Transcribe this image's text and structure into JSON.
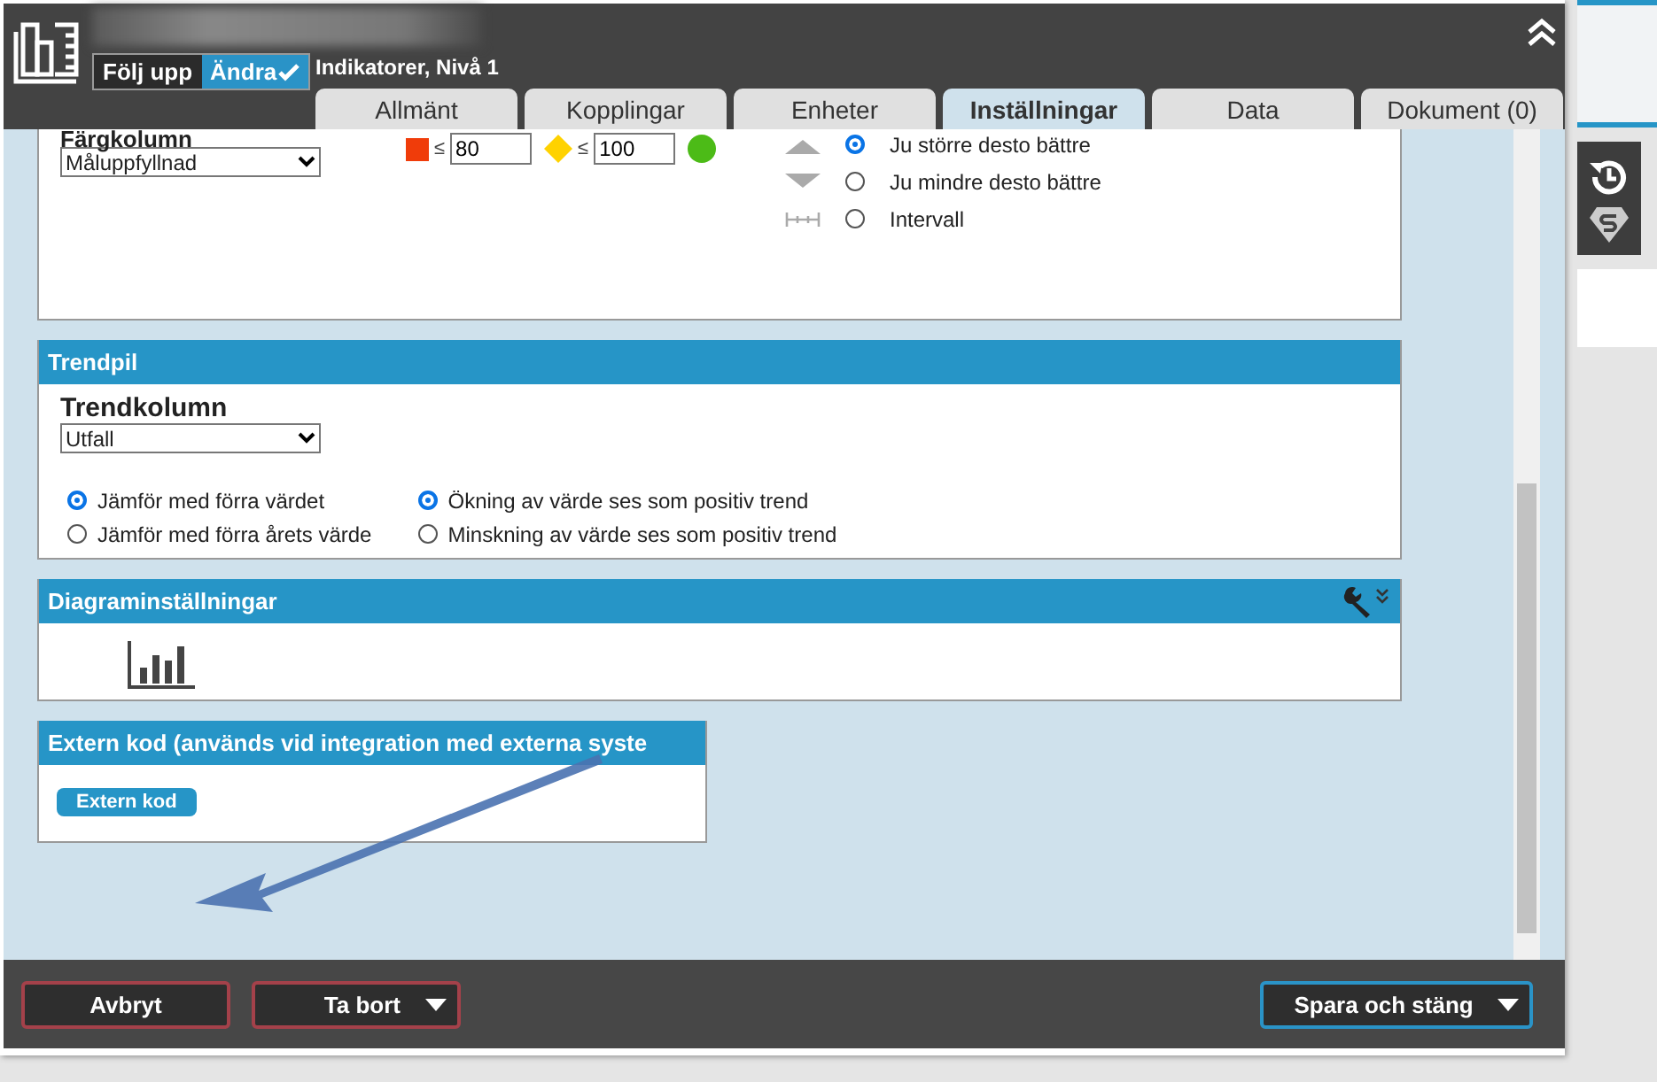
{
  "header": {
    "title": "Indikatorer, Nivå 1",
    "mode_toggle": [
      {
        "label": "Följ upp",
        "selected": false
      },
      {
        "label": "Ändra",
        "selected": true
      }
    ]
  },
  "tabs": [
    {
      "label": "Allmänt",
      "selected": false
    },
    {
      "label": "Kopplingar",
      "selected": false
    },
    {
      "label": "Enheter",
      "selected": false
    },
    {
      "label": "Inställningar",
      "selected": true
    },
    {
      "label": "Data",
      "selected": false
    },
    {
      "label": "Dokument (0)",
      "selected": false
    }
  ],
  "color_panel": {
    "label": "Färgkolumn",
    "select": "Måluppfyllnad",
    "thresholds": [
      {
        "symbol": "≤",
        "value": "80"
      },
      {
        "symbol": "≤",
        "value": "100"
      }
    ],
    "direction_options": [
      {
        "label": "Ju större desto bättre",
        "selected": true,
        "kind": "up"
      },
      {
        "label": "Ju mindre desto bättre",
        "selected": false,
        "kind": "down"
      },
      {
        "label": "Intervall",
        "selected": false,
        "kind": "interval"
      }
    ]
  },
  "trend_panel": {
    "title": "Trendpil",
    "label": "Trendkolumn",
    "select": "Utfall",
    "compare_options": [
      {
        "label": "Jämför med förra värdet",
        "selected": true
      },
      {
        "label": "Jämför med förra årets värde",
        "selected": false
      }
    ],
    "direction_options": [
      {
        "label": "Ökning av värde ses som positiv trend",
        "selected": true
      },
      {
        "label": "Minskning av värde ses som positiv trend",
        "selected": false
      }
    ]
  },
  "chart_panel": {
    "title": "Diagraminställningar"
  },
  "external_code_panel": {
    "title": "Extern kod (används vid integration med externa syste",
    "button": "Extern kod"
  },
  "footer": {
    "buttons": [
      {
        "label": "Avbryt",
        "kind": "plain"
      },
      {
        "label": "Ta bort",
        "kind": "dropdown"
      }
    ],
    "save_button": "Spara och stäng"
  }
}
